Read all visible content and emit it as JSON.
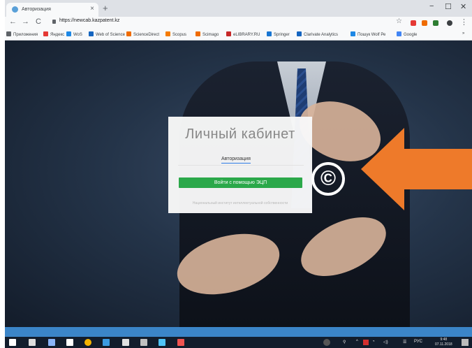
{
  "browser": {
    "tab_title": "Авторизация",
    "tab_close": "×",
    "new_tab": "+",
    "url": "https://newcab.kazpatent.kz",
    "win_minimize": "−",
    "win_maximize": "☐",
    "win_close": "✕",
    "back": "←",
    "forward": "→",
    "reload": "C",
    "star": "☆",
    "menu": "⋮",
    "bookmarks": [
      {
        "label": "Приложения",
        "color": "#5f6368"
      },
      {
        "label": "Яндекс",
        "color": "#e53935"
      },
      {
        "label": "WoS",
        "color": "#1e88e5"
      },
      {
        "label": "Web of Science",
        "color": "#1565c0"
      },
      {
        "label": "ScienceDirect",
        "color": "#ef6c00"
      },
      {
        "label": "Scopus",
        "color": "#f57c00"
      },
      {
        "label": "Scimago",
        "color": "#ef6c00"
      },
      {
        "label": "eLIBRARY.RU",
        "color": "#c62828"
      },
      {
        "label": "Springer",
        "color": "#1976d2"
      },
      {
        "label": "Clarivate Analytics",
        "color": "#1565c0"
      },
      {
        "label": "Пошук Wolf Ре",
        "color": "#1e88e5"
      },
      {
        "label": "Google",
        "color": "#4285f4"
      }
    ],
    "bookmarks_more": "»"
  },
  "login": {
    "title": "Личный кабинет",
    "tab_label": "Авторизация",
    "submit_label": "Войти с помощью ЭЦП",
    "footer": "Национальный институт интеллектуальной собственности"
  },
  "overlay": {
    "copyright_symbol": "©",
    "arrow_color": "#ee7a2a"
  },
  "taskbar": {
    "tray_label": "РУС",
    "time": "9:48",
    "date": "07.11.2018",
    "icons": [
      "start-icon",
      "search-icon",
      "task-view-icon",
      "mail-icon",
      "chrome-icon",
      "edge-icon",
      "store-icon",
      "pen-icon",
      "photos-icon",
      "app-icon"
    ]
  },
  "colors": {
    "taskbar_stripe": "#3b85c8",
    "taskbar_bg": "#121d2c",
    "login_button": "#2ba84a"
  }
}
